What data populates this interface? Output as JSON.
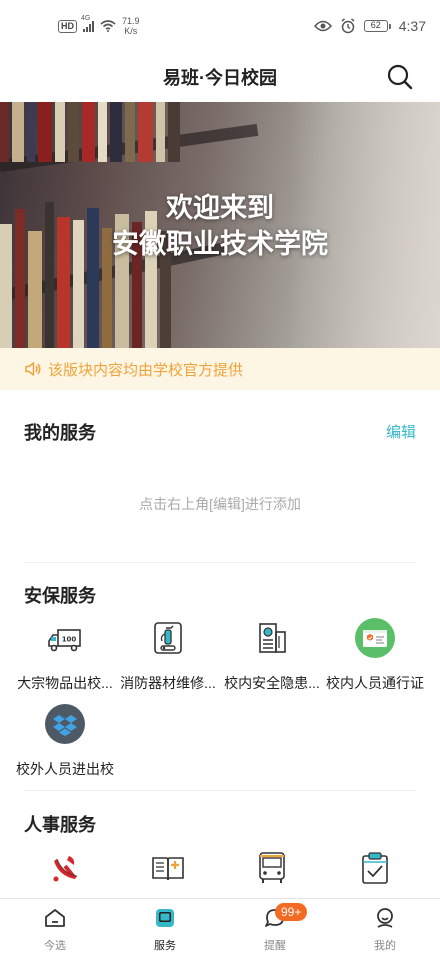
{
  "status_bar": {
    "hd": "HD",
    "signal": "4G",
    "net_speed_value": "71.9",
    "net_speed_unit": "K/s",
    "battery": "62",
    "time": "4:37"
  },
  "header": {
    "title": "易班·今日校园"
  },
  "banner": {
    "line1": "欢迎来到",
    "line2": "安徽职业技术学院"
  },
  "notice": {
    "text": "该版块内容均由学校官方提供"
  },
  "my_services": {
    "heading": "我的服务",
    "edit": "编辑",
    "empty_hint": "点击右上角[编辑]进行添加"
  },
  "security_services": {
    "heading": "安保服务",
    "items": [
      {
        "label": "大宗物品出校...",
        "icon": "truck-icon"
      },
      {
        "label": "消防器材维修...",
        "icon": "fire-extinguisher-icon"
      },
      {
        "label": "校内安全隐患...",
        "icon": "building-report-icon"
      },
      {
        "label": "校内人员通行证",
        "icon": "pass-card-icon"
      },
      {
        "label": "校外人员进出校",
        "icon": "dropbox-box-icon"
      }
    ]
  },
  "hr_services": {
    "heading": "人事服务",
    "items": [
      {
        "label": "",
        "icon": "party-emblem-icon"
      },
      {
        "label": "",
        "icon": "open-book-icon"
      },
      {
        "label": "",
        "icon": "bus-icon"
      },
      {
        "label": "",
        "icon": "clipboard-check-icon"
      }
    ]
  },
  "tab_bar": {
    "tabs": [
      {
        "label": "今选",
        "icon": "home-icon"
      },
      {
        "label": "服务",
        "icon": "service-icon"
      },
      {
        "label": "提醒",
        "icon": "chat-bubble-icon",
        "badge": "99+"
      },
      {
        "label": "我的",
        "icon": "person-icon"
      }
    ]
  },
  "colors": {
    "accent": "#35b8c9",
    "notice_text": "#f0a33a",
    "notice_bg": "#fdf6e5",
    "badge": "#f36a22",
    "pass_green": "#5bbf6a",
    "box_dark": "#4d5a66"
  }
}
